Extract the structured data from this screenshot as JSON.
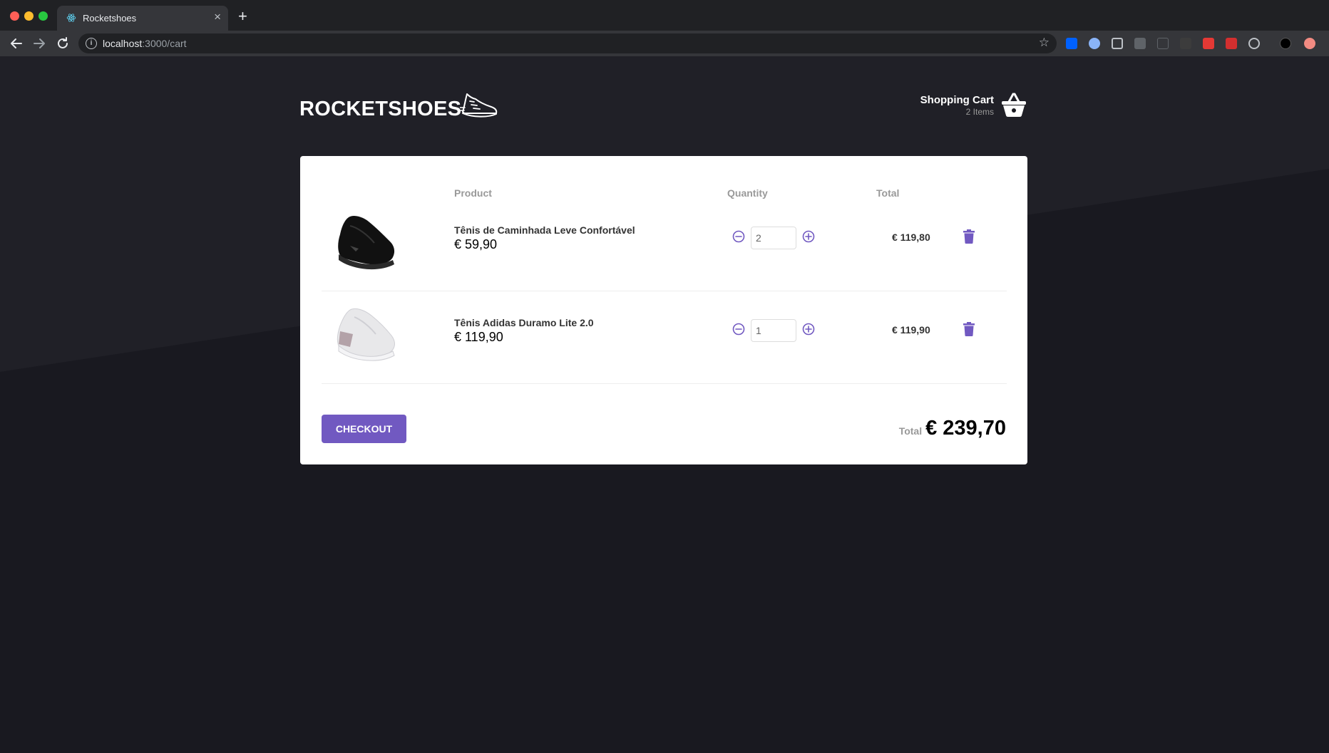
{
  "browser": {
    "tab_title": "Rocketshoes",
    "url_host": "localhost",
    "url_path": ":3000/cart",
    "new_tab_symbol": "+",
    "close_symbol": "×"
  },
  "header": {
    "logo": "ROCKETSHOES",
    "cart_title": "Shopping Cart",
    "cart_count": "2 Items"
  },
  "table": {
    "columns": [
      "Product",
      "Quantity",
      "Total"
    ]
  },
  "items": [
    {
      "name": "Tênis de Caminhada Leve Confortável",
      "price": "€ 59,90",
      "quantity": "2",
      "subtotal": "€ 119,80",
      "image": "black-sneaker"
    },
    {
      "name": "Tênis Adidas Duramo Lite 2.0",
      "price": "€ 119,90",
      "quantity": "1",
      "subtotal": "€ 119,90",
      "image": "white-sneaker"
    }
  ],
  "footer": {
    "checkout_label": "Checkout",
    "total_label": "Total",
    "total_value": "€ 239,70"
  },
  "colors": {
    "accent": "#7159c1",
    "background": "#191920",
    "card": "#ffffff"
  }
}
